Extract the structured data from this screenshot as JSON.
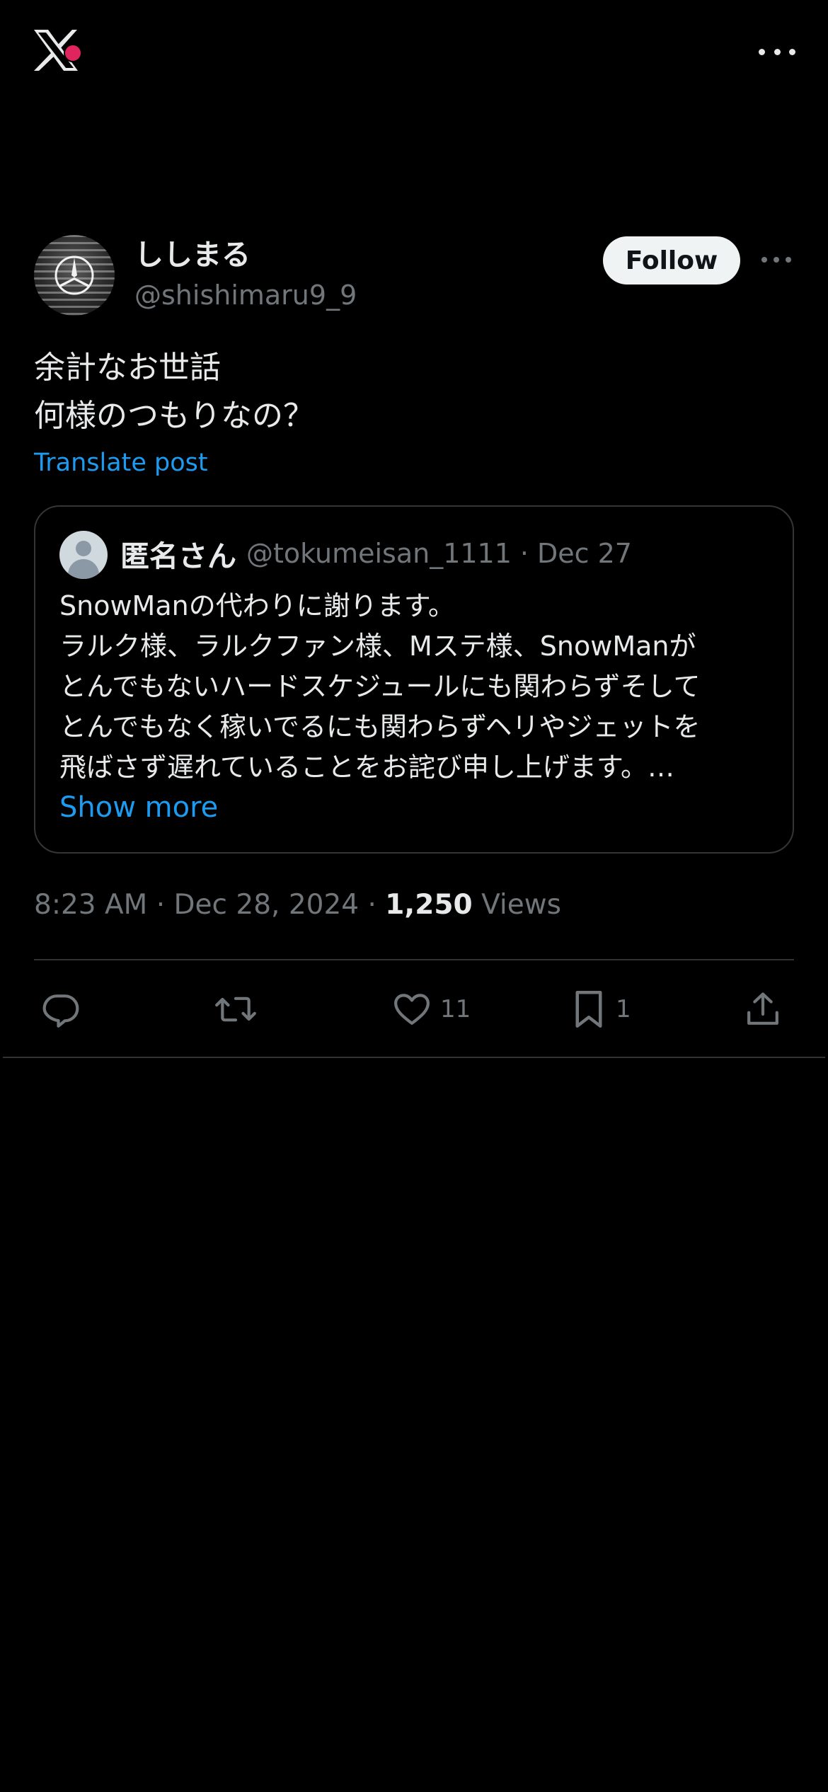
{
  "app": {
    "logo_icon": "x-logo-icon",
    "more_icon": "more-horizontal-icon"
  },
  "post": {
    "author": {
      "display_name": "ししまる",
      "handle": "@shishimaru9_9"
    },
    "follow_label": "Follow",
    "text_lines": [
      "余計なお世話",
      "何様のつもりなの？"
    ],
    "translate_label": "Translate post",
    "quoted": {
      "name": "匿名さん",
      "handle": "@tokumeisan_1111",
      "separator": "·",
      "date": "Dec 27",
      "lines": [
        "SnowManの代わりに謝ります。",
        "ラルク様、ラルクファン様、Mステ様、SnowManが",
        "とんでもないハードスケジュールにも関わらずそして",
        "とんでもなく稼いでるにも関わらずヘリやジェットを",
        "飛ばさず遅れていることをお詫び申し上げます。…"
      ],
      "show_more_label": "Show more"
    },
    "time": "8:23 AM",
    "date": "Dec 28, 2024",
    "separator": "·",
    "views_count": "1,250",
    "views_label": "Views",
    "actions": {
      "reply": {
        "icon": "reply-icon",
        "count": ""
      },
      "repost": {
        "icon": "repost-icon",
        "count": ""
      },
      "like": {
        "icon": "heart-icon",
        "count": "11"
      },
      "bookmark": {
        "icon": "bookmark-icon",
        "count": "1"
      },
      "share": {
        "icon": "share-icon",
        "count": ""
      }
    }
  },
  "colors": {
    "background": "#000000",
    "text_primary": "#e7e9ea",
    "text_secondary": "#71767b",
    "accent": "#1d9bf0",
    "border": "#2f3336"
  }
}
